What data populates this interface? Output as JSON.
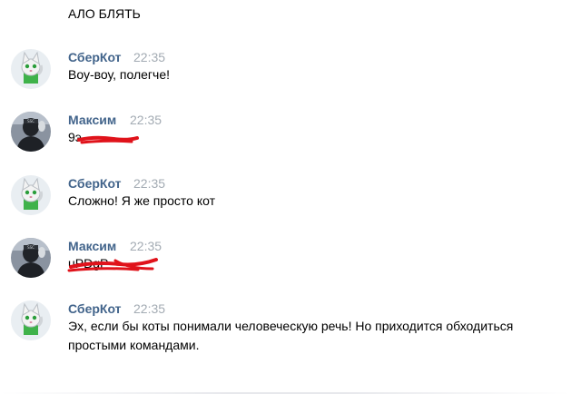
{
  "top_message": "АЛО БЛЯТЬ",
  "messages": [
    {
      "author": "СберКот",
      "time": "22:35",
      "text": "Воу-воу, полегче!",
      "avatar": "cat-avatar"
    },
    {
      "author": "Максим",
      "time": "22:35",
      "text": "9э",
      "avatar": "user-avatar"
    },
    {
      "author": "СберКот",
      "time": "22:35",
      "text": "Сложно! Я же просто кот",
      "avatar": "cat-avatar"
    },
    {
      "author": "Максим",
      "time": "22:35",
      "text": "uPDgP",
      "avatar": "user-avatar"
    },
    {
      "author": "СберКот",
      "time": "22:35",
      "text": "Эх, если бы коты понимали человеческую речь! Но приходится обходиться простыми командами.",
      "avatar": "cat-avatar"
    }
  ],
  "colors": {
    "author": "#42648b",
    "time": "#a3abb3",
    "redaction": "#e0131b"
  }
}
